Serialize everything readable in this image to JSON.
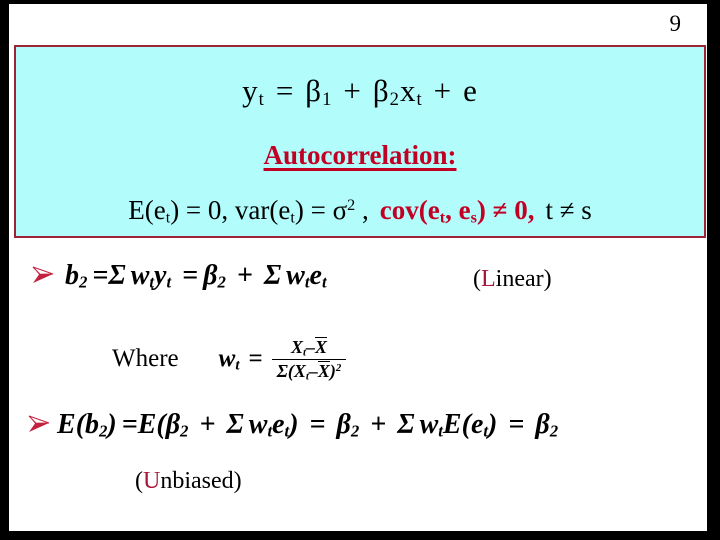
{
  "slide": {
    "page_number": "9",
    "colors": {
      "box_fill": "#b2fcfc",
      "box_border": "#9c2436",
      "accent_red": "#c20024",
      "cap_red": "#a8163a",
      "frame": "#000000",
      "text": "#000000"
    },
    "boxed": {
      "model_equation": "yt = β1 + β2xt + e",
      "model_parts": {
        "y": "y",
        "y_sub": "t",
        "eq": "=",
        "beta": "β",
        "beta1_sub": "1",
        "plus": "+",
        "beta2_sub": "2",
        "x": "x",
        "x_sub": "t",
        "e": "e"
      },
      "heading": "Autocorrelation:",
      "assumptions": {
        "mean_full": "E(et) = 0, var(et) = σ2 ,",
        "mean_label": "E(e",
        "mean_sub": "t",
        "mean_tail": ") = 0, var(e",
        "mean_tail2": ") = ",
        "sigma": "σ",
        "sigma_sup": "2",
        "comma": " ,",
        "cov_red": "cov(et, es) ≠ 0,",
        "cov_open": "cov(e",
        "cov_sub_t": "t",
        "cov_mid": ", e",
        "cov_sub_s": "s",
        "cov_close": ") ≠ 0,",
        "index_cond": "t ≠ s"
      }
    },
    "body": {
      "bullet_icon": "arrow-bullet-icon",
      "line1": {
        "formula_text": "b2 = Σ wtyt = β2 + Σ wtet",
        "b": "b",
        "b_sub": "2",
        "eq1": "=Σ",
        "w": "w",
        "w_sub": "t",
        "y": "y",
        "y_sub": "t",
        "eq2": "=",
        "beta": "β",
        "beta_sub": "2",
        "plus": "+",
        "sigma_sum": "Σ",
        "e": "e",
        "e_sub": "t",
        "tag": "(Linear)",
        "tag_cap": "L",
        "tag_open": "(",
        "tag_rest": "inear)"
      },
      "where": {
        "label": "Where",
        "lhs": "w",
        "lhs_sub": "t",
        "equals": "=",
        "numerator": "Xt - X̄",
        "num_x": "X",
        "num_x_sub": "t",
        "num_minus": "–",
        "num_xbar": "X",
        "denominator": "Σ(Xt - X̄)2",
        "den_sum": "Σ(",
        "den_x": "X",
        "den_x_sub": "t",
        "den_minus": "–",
        "den_xbar": "X",
        "den_close": ")",
        "den_sup": "2"
      },
      "line2": {
        "formula_text": "E(b2) =E(β2 + Σ wtet) = β2 + Σ wtE(et) = β2",
        "E": "E",
        "open": "(",
        "b": "b",
        "b_sub": "2",
        "close": ")",
        "eq1": "=E(",
        "beta": "β",
        "beta_sub": "2",
        "plus": "+",
        "sum": "Σ",
        "w": "w",
        "w_sub": "t",
        "e": "e",
        "e_sub": "t",
        "eq2": "=",
        "eq3": "=",
        "tag": "(Unbiased)",
        "tag_cap": "U",
        "tag_open": "(",
        "tag_rest": "nbiased)"
      }
    }
  }
}
